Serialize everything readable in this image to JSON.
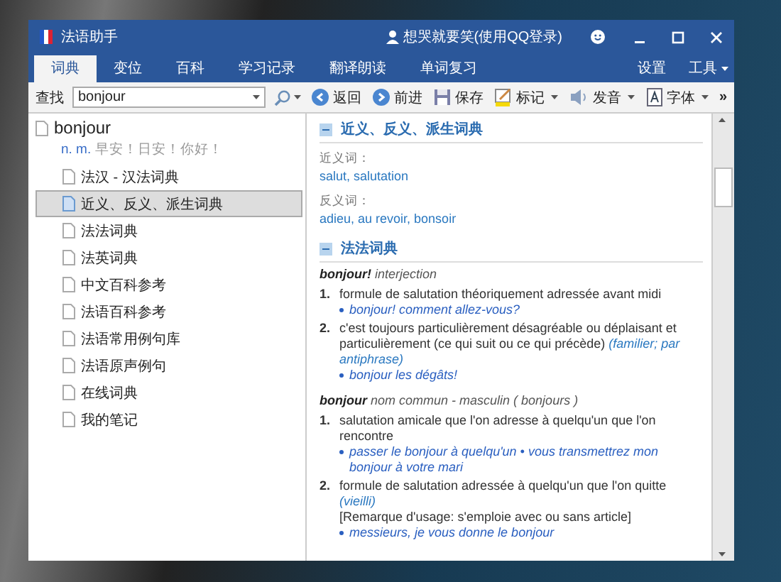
{
  "window": {
    "title": "法语助手",
    "account": "想哭就要笑(使用QQ登录)"
  },
  "tabs": [
    {
      "label": "词典",
      "selected": true
    },
    {
      "label": "变位",
      "selected": false
    },
    {
      "label": "百科",
      "selected": false
    },
    {
      "label": "学习记录",
      "selected": false
    },
    {
      "label": "翻译朗读",
      "selected": false
    },
    {
      "label": "单词复习",
      "selected": false
    }
  ],
  "menu": [
    "设置",
    "工具"
  ],
  "toolbar": {
    "search_label": "查找",
    "search_value": "bonjour",
    "overflow": "»",
    "buttons": [
      {
        "kind": "back",
        "label": "返回",
        "has_menu": false
      },
      {
        "kind": "forward",
        "label": "前进",
        "has_menu": false
      },
      {
        "kind": "save",
        "label": "保存",
        "has_menu": false
      },
      {
        "kind": "mark",
        "label": "标记",
        "has_menu": true
      },
      {
        "kind": "sound",
        "label": "发音",
        "has_menu": true
      },
      {
        "kind": "font",
        "label": "字体",
        "has_menu": true
      }
    ]
  },
  "sidebar": {
    "headword": "bonjour",
    "pos": "n. m.",
    "gloss": "早安！日安！你好！",
    "items": [
      {
        "label": "法汉 - 汉法词典",
        "selected": false
      },
      {
        "label": "近义、反义、派生词典",
        "selected": true
      },
      {
        "label": "法法词典",
        "selected": false
      },
      {
        "label": "法英词典",
        "selected": false
      },
      {
        "label": "中文百科参考",
        "selected": false
      },
      {
        "label": "法语百科参考",
        "selected": false
      },
      {
        "label": "法语常用例句库",
        "selected": false
      },
      {
        "label": "法语原声例句",
        "selected": false
      },
      {
        "label": "在线词典",
        "selected": false
      },
      {
        "label": "我的笔记",
        "selected": false
      }
    ]
  },
  "content": {
    "sections": [
      {
        "title": "近义、反义、派生词典",
        "groups": [
          {
            "label": "近义词：",
            "words": "salut, salutation"
          },
          {
            "label": "反义词：",
            "words": "adieu, au revoir, bonsoir"
          }
        ]
      },
      {
        "title": "法法词典",
        "entries": [
          {
            "head": "bonjour!",
            "gram": "interjection",
            "senses": [
              {
                "num": "1.",
                "text": "formule de salutation théoriquement adressée avant midi",
                "examples": [
                  "bonjour! comment allez-vous?"
                ]
              },
              {
                "num": "2.",
                "text": "c'est toujours particulièrement désagréable ou déplaisant et particulièrement (ce qui suit ou ce qui précède)",
                "note": "(familier; par antiphrase)",
                "examples": [
                  "bonjour les dégâts!"
                ]
              }
            ]
          },
          {
            "head": "bonjour",
            "gram": "nom commun - masculin ( bonjours )",
            "senses": [
              {
                "num": "1.",
                "text": "salutation amicale que l'on adresse à quelqu'un que l'on rencontre",
                "examples": [
                  "passer le bonjour à quelqu'un • vous transmettrez mon bonjour à votre mari"
                ]
              },
              {
                "num": "2.",
                "text": "formule de salutation adressée à quelqu'un que l'on quitte",
                "note": "(vieilli)",
                "remark": "[Remarque d'usage: s'emploie avec ou sans article]",
                "examples": [
                  "messieurs, je vous donne le bonjour"
                ]
              }
            ]
          }
        ]
      }
    ]
  }
}
